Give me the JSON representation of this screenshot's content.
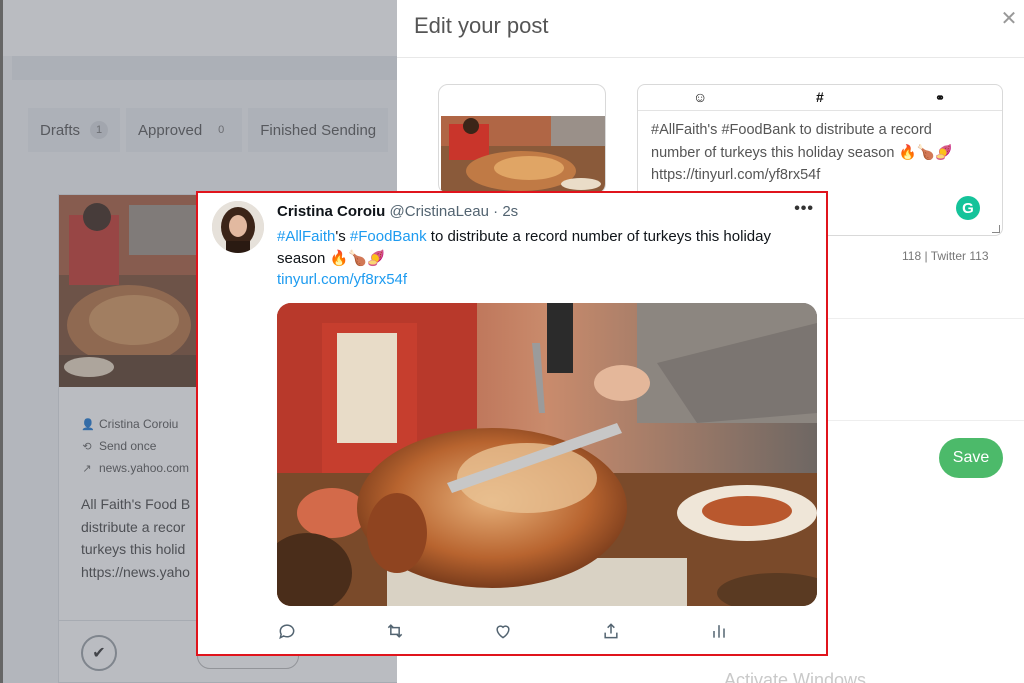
{
  "background_app": {
    "tabs": [
      {
        "label": "Drafts",
        "count": "1"
      },
      {
        "label": "Approved",
        "count": "0"
      },
      {
        "label": "Finished Sending",
        "count": ""
      }
    ],
    "card": {
      "author": "Cristina Coroiu",
      "schedule": "Send once",
      "source": "news.yahoo.com",
      "text_lines": [
        "All Faith's Food B",
        "distribute a recor",
        "turkeys this holid",
        "https://news.yaho"
      ]
    }
  },
  "panel": {
    "title": "Edit your post",
    "close_icon": "close-icon",
    "editor": {
      "toolbar_icons": [
        "emoji-icon",
        "hashtag-icon",
        "link-icon"
      ],
      "text_line1": "#AllFaith's #FoodBank to distribute a record",
      "text_line2": "number of turkeys this holiday season",
      "text_emojis": "🔥🍗🍠",
      "text_line3": "https://tinyurl.com/yf8rx54f",
      "grammarly_letter": "G"
    },
    "char_count": "118 | Twitter 113",
    "save_label": "Save",
    "watermark": "Activate Windows"
  },
  "tweet": {
    "name": "Cristina Coroiu",
    "handle": "@CristinaLeau",
    "separator": "·",
    "time": "2s",
    "more_icon": "•••",
    "hashtag1": "#AllFaith",
    "text_part1": "'s ",
    "hashtag2": "#FoodBank",
    "text_part2": " to distribute a record number of turkeys this holiday season ",
    "emojis": "🔥🍗🍠",
    "link": "tinyurl.com/yf8rx54f",
    "actions": [
      "reply-icon",
      "retweet-icon",
      "like-icon",
      "share-icon",
      "analytics-icon"
    ]
  },
  "colors": {
    "highlight_border": "#e0141c",
    "link_blue": "#1d9bf0",
    "save_green": "#4cba6a",
    "grammarly_green": "#15c39a"
  }
}
